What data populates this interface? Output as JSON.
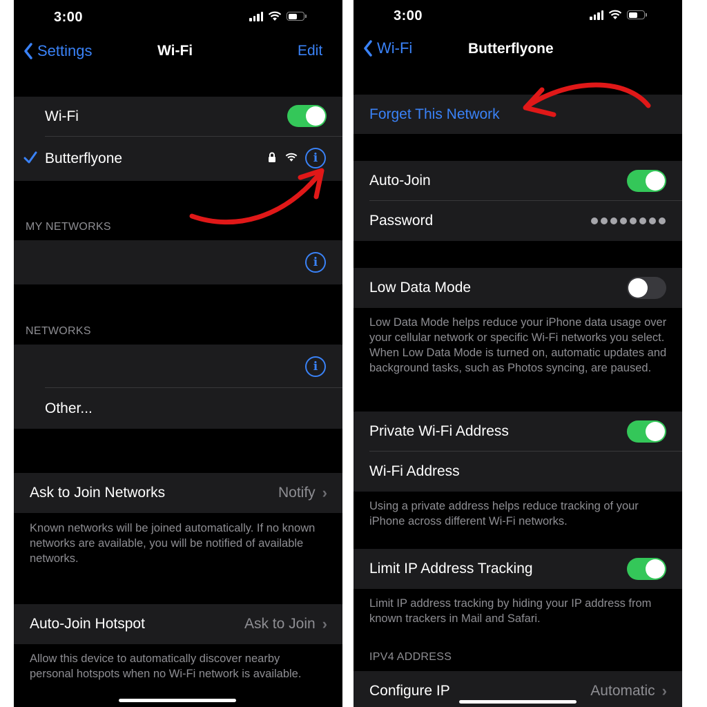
{
  "left_screen": {
    "status_bar": {
      "time": "3:00"
    },
    "nav": {
      "back_label": "Settings",
      "title": "Wi-Fi",
      "edit_label": "Edit"
    },
    "wifi_toggle": {
      "label": "Wi-Fi",
      "state": "on"
    },
    "connected_network": {
      "name": "Butterflyone",
      "secured": true,
      "icons": [
        "checkmark-icon",
        "lock-icon",
        "wifi-icon",
        "info-icon"
      ]
    },
    "my_networks": {
      "header": "MY NETWORKS"
    },
    "networks": {
      "header": "NETWORKS",
      "other_label": "Other..."
    },
    "ask_to_join": {
      "label": "Ask to Join Networks",
      "value": "Notify",
      "footnote": "Known networks will be joined automatically. If no known networks are available, you will be notified of available networks."
    },
    "auto_join_hotspot": {
      "label": "Auto-Join Hotspot",
      "value": "Ask to Join",
      "footnote": "Allow this device to automatically discover nearby personal hotspots when no Wi-Fi network is available."
    }
  },
  "right_screen": {
    "status_bar": {
      "time": "3:00"
    },
    "nav": {
      "back_label": "Wi-Fi",
      "title": "Butterflyone"
    },
    "forget_network_label": "Forget This Network",
    "auto_join": {
      "label": "Auto-Join",
      "state": "on"
    },
    "password": {
      "label": "Password",
      "masked_length": 8
    },
    "low_data_mode": {
      "label": "Low Data Mode",
      "state": "off",
      "footnote": "Low Data Mode helps reduce your iPhone data usage over your cellular network or specific Wi-Fi networks you select. When Low Data Mode is turned on, automatic updates and background tasks, such as Photos syncing, are paused."
    },
    "private_address": {
      "label": "Private Wi-Fi Address",
      "state": "on",
      "address_label": "Wi-Fi Address",
      "footnote": "Using a private address helps reduce tracking of your iPhone across different Wi-Fi networks."
    },
    "limit_ip_tracking": {
      "label": "Limit IP Address Tracking",
      "state": "on",
      "footnote": "Limit IP address tracking by hiding your IP address from known trackers in Mail and Safari."
    },
    "ipv4": {
      "header": "IPV4 ADDRESS",
      "configure_label": "Configure IP",
      "configure_value": "Automatic"
    }
  },
  "colors": {
    "accent_blue": "#3a82f7",
    "toggle_green": "#34c759",
    "annotation_red": "#e01818",
    "cell_bg": "#1c1c1e",
    "secondary_text": "#8e8e93"
  }
}
